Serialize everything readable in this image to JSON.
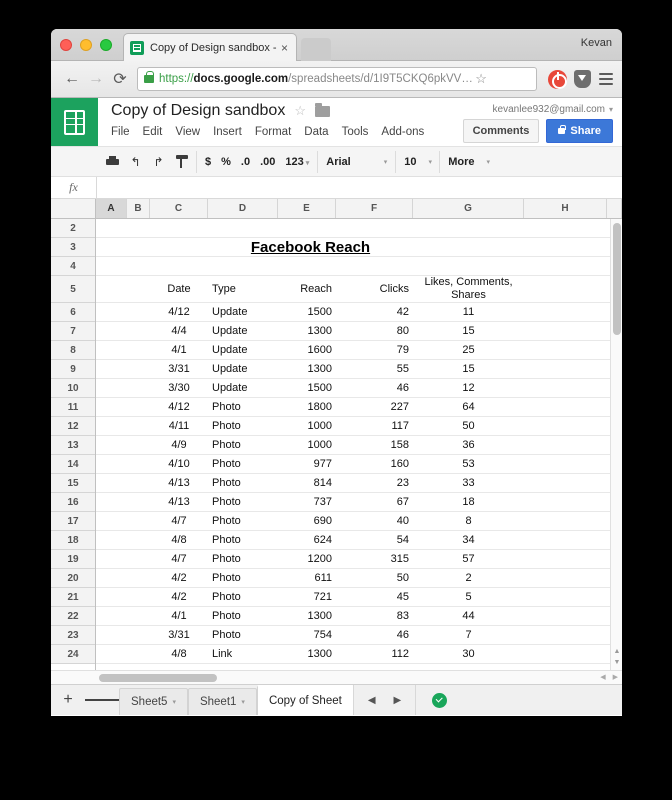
{
  "browser": {
    "tab": {
      "title": "Copy of Design sandbox - ",
      "close_label": "×",
      "favicon": "sheets-icon"
    },
    "profile_name": "Kevan",
    "nav": {
      "back": "←",
      "forward": "→",
      "reload": "⟳"
    },
    "url": {
      "scheme": "https://",
      "host": "docs.google.com",
      "path": "/spreadsheets/d/1I9T5CKQ6pkVV…"
    },
    "star_glyph": "☆"
  },
  "docs": {
    "title": "Copy of Design sandbox",
    "account_email": "kevanlee932@gmail.com",
    "menus": [
      "File",
      "Edit",
      "View",
      "Insert",
      "Format",
      "Data",
      "Tools",
      "Add-ons"
    ],
    "comments_label": "Comments",
    "share_label": "Share"
  },
  "toolbar": {
    "currency": "$",
    "percent": "%",
    "decrease_decimal": ".0",
    "increase_decimal": ".00",
    "number_format": "123",
    "font_family": "Arial",
    "font_size": "10",
    "more_label": "More",
    "caret": "▾"
  },
  "formula_bar": {
    "fx_label": "fx",
    "value": ""
  },
  "grid": {
    "columns": [
      "A",
      "B",
      "C",
      "D",
      "E",
      "F",
      "G",
      "H"
    ],
    "selected_column": "A",
    "row_numbers": [
      "2",
      "3",
      "4",
      "5",
      "6",
      "7",
      "8",
      "9",
      "10",
      "11",
      "12",
      "13",
      "14",
      "15",
      "16",
      "17",
      "18",
      "19",
      "20",
      "21",
      "22",
      "23",
      "24"
    ],
    "title_cell": "Facebook Reach",
    "headers": {
      "date": "Date",
      "type": "Type",
      "reach": "Reach",
      "clicks": "Clicks",
      "engagement": "Likes, Comments, Shares"
    },
    "rows": [
      {
        "row": "6",
        "date": "4/12",
        "type": "Update",
        "reach": "1500",
        "clicks": "42",
        "engagement": "11"
      },
      {
        "row": "7",
        "date": "4/4",
        "type": "Update",
        "reach": "1300",
        "clicks": "80",
        "engagement": "15"
      },
      {
        "row": "8",
        "date": "4/1",
        "type": "Update",
        "reach": "1600",
        "clicks": "79",
        "engagement": "25"
      },
      {
        "row": "9",
        "date": "3/31",
        "type": "Update",
        "reach": "1300",
        "clicks": "55",
        "engagement": "15"
      },
      {
        "row": "10",
        "date": "3/30",
        "type": "Update",
        "reach": "1500",
        "clicks": "46",
        "engagement": "12"
      },
      {
        "row": "11",
        "date": "4/12",
        "type": "Photo",
        "reach": "1800",
        "clicks": "227",
        "engagement": "64"
      },
      {
        "row": "12",
        "date": "4/11",
        "type": "Photo",
        "reach": "1000",
        "clicks": "117",
        "engagement": "50"
      },
      {
        "row": "13",
        "date": "4/9",
        "type": "Photo",
        "reach": "1000",
        "clicks": "158",
        "engagement": "36"
      },
      {
        "row": "14",
        "date": "4/10",
        "type": "Photo",
        "reach": "977",
        "clicks": "160",
        "engagement": "53"
      },
      {
        "row": "15",
        "date": "4/13",
        "type": "Photo",
        "reach": "814",
        "clicks": "23",
        "engagement": "33"
      },
      {
        "row": "16",
        "date": "4/13",
        "type": "Photo",
        "reach": "737",
        "clicks": "67",
        "engagement": "18"
      },
      {
        "row": "17",
        "date": "4/7",
        "type": "Photo",
        "reach": "690",
        "clicks": "40",
        "engagement": "8"
      },
      {
        "row": "18",
        "date": "4/8",
        "type": "Photo",
        "reach": "624",
        "clicks": "54",
        "engagement": "34"
      },
      {
        "row": "19",
        "date": "4/7",
        "type": "Photo",
        "reach": "1200",
        "clicks": "315",
        "engagement": "57"
      },
      {
        "row": "20",
        "date": "4/2",
        "type": "Photo",
        "reach": "611",
        "clicks": "50",
        "engagement": "2"
      },
      {
        "row": "21",
        "date": "4/2",
        "type": "Photo",
        "reach": "721",
        "clicks": "45",
        "engagement": "5"
      },
      {
        "row": "22",
        "date": "4/1",
        "type": "Photo",
        "reach": "1300",
        "clicks": "83",
        "engagement": "44"
      },
      {
        "row": "23",
        "date": "3/31",
        "type": "Photo",
        "reach": "754",
        "clicks": "46",
        "engagement": "7"
      },
      {
        "row": "24",
        "date": "4/8",
        "type": "Link",
        "reach": "1300",
        "clicks": "112",
        "engagement": "30"
      }
    ]
  },
  "sheetbar": {
    "add_label": "+",
    "tabs": [
      {
        "label": "Sheet5",
        "active": false
      },
      {
        "label": "Sheet1",
        "active": false
      },
      {
        "label": "Copy of Sheet",
        "active": true
      }
    ],
    "prev_glyph": "◀",
    "next_glyph": "▶",
    "status": "saved-check-icon"
  },
  "colors": {
    "sheets_green": "#1ca25e",
    "share_blue": "#3c78d8",
    "saved_green": "#19a65a"
  }
}
